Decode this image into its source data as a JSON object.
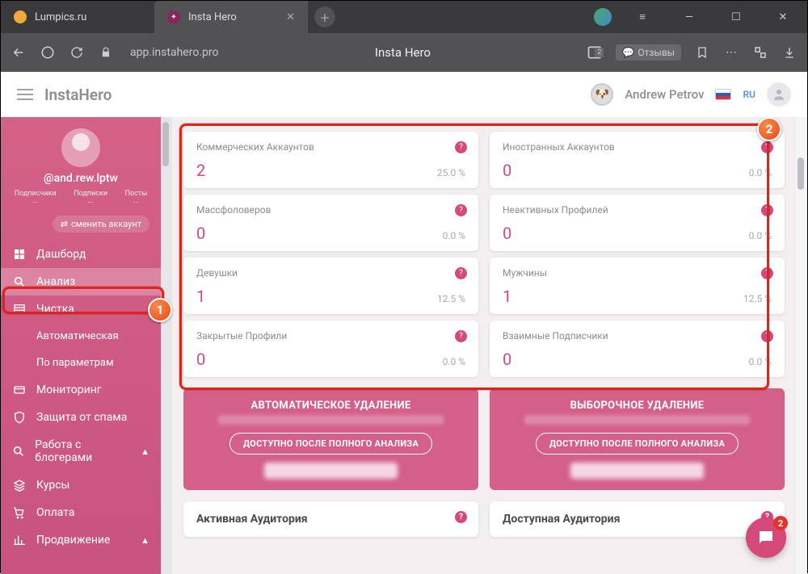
{
  "browser": {
    "tabs": [
      {
        "title": "Lumpics.ru"
      },
      {
        "title": "Insta Hero"
      }
    ],
    "url": "app.instahero.pro",
    "page_title": "Insta Hero",
    "reviews_label": "Отзывы",
    "sidebar_badge": "2"
  },
  "app": {
    "title": "InstaHero",
    "user": "Andrew Petrov",
    "lang": "RU"
  },
  "sidebar": {
    "handle": "@and.rew.lptw",
    "tabs": [
      "Подписчики",
      "Подписки",
      "Посты"
    ],
    "dots": [
      "···",
      "···",
      "···"
    ],
    "switch_label": "сменить аккаунт",
    "items": [
      {
        "icon": "dashboard",
        "label": "Дашборд"
      },
      {
        "icon": "search",
        "label": "Анализ",
        "active": true
      },
      {
        "icon": "list",
        "label": "Чистка"
      },
      {
        "icon": "",
        "label": "Автоматическая",
        "sub": true
      },
      {
        "icon": "",
        "label": "По параметрам",
        "sub": true
      },
      {
        "icon": "card",
        "label": "Мониторинг"
      },
      {
        "icon": "shield",
        "label": "Защита от спама"
      },
      {
        "icon": "search2",
        "label": "Работа с блогерами",
        "chev": true
      },
      {
        "icon": "layers",
        "label": "Курсы"
      },
      {
        "icon": "cart",
        "label": "Оплата"
      },
      {
        "icon": "chart",
        "label": "Продвижение",
        "chev": true
      }
    ]
  },
  "cards": [
    {
      "title": "Коммерческих Аккаунтов",
      "value": "2",
      "pct": "25.0 %"
    },
    {
      "title": "Иностранных Аккаунтов",
      "value": "0",
      "pct": "0.0 %"
    },
    {
      "title": "Массфоловеров",
      "value": "0",
      "pct": "0.0 %"
    },
    {
      "title": "Неактивных Профилей",
      "value": "0",
      "pct": "0.0 %"
    },
    {
      "title": "Девушки",
      "value": "1",
      "pct": "12.5 %"
    },
    {
      "title": "Мужчины",
      "value": "1",
      "pct": "12.5 %"
    },
    {
      "title": "Закрытые Профили",
      "value": "0",
      "pct": "0.0 %"
    },
    {
      "title": "Взаимные Подписчики",
      "value": "0",
      "pct": "0.0 %"
    }
  ],
  "banners": [
    {
      "title": "АВТОМАТИЧЕСКОЕ УДАЛЕНИЕ",
      "btn": "ДОСТУПНО ПОСЛЕ ПОЛНОГО АНАЛИЗА"
    },
    {
      "title": "ВЫБОРОЧНОЕ УДАЛЕНИЕ",
      "btn": "ДОСТУПНО ПОСЛЕ ПОЛНОГО АНАЛИЗА"
    }
  ],
  "bottom_cards": [
    {
      "title": "Активная Аудитория"
    },
    {
      "title": "Доступная Аудитория"
    }
  ],
  "chat_badge": "2",
  "anno": {
    "b1": "1",
    "b2": "2"
  }
}
